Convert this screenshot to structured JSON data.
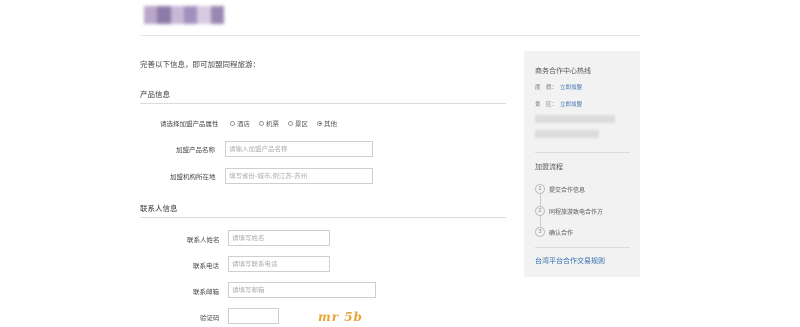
{
  "colors": {
    "logo": [
      "#b9a6c8",
      "#8d7aa8",
      "#c7b8d6",
      "#a38fbd",
      "#d6cbe1",
      "#9a88b3"
    ],
    "accent_link": "#2d6cb0",
    "captcha": "#e6a536"
  },
  "intro": "完善以下信息，即可加盟同程旅游：",
  "product": {
    "section_title": "产品信息",
    "attr_label": "请选择加盟产品属性",
    "options": [
      {
        "label": "酒店",
        "checked": false
      },
      {
        "label": "机票",
        "checked": false
      },
      {
        "label": "景区",
        "checked": false
      },
      {
        "label": "其他",
        "checked": true
      }
    ],
    "name_label": "加盟产品名称",
    "name_placeholder": "请输入加盟产品名称",
    "location_label": "加盟机构所在地",
    "location_placeholder": "填写省份-城市,例江苏-苏州"
  },
  "contact": {
    "section_title": "联系人信息",
    "name_label": "联系人姓名",
    "name_placeholder": "请填写姓名",
    "phone_label": "联系电话",
    "phone_placeholder": "请填写联系电话",
    "email_label": "联系邮箱",
    "email_placeholder": "请填写邮箱",
    "captcha_label": "验证码",
    "captcha_text": "mr 5b"
  },
  "sidebar": {
    "hotline_title": "商务合作中心热线",
    "rows": [
      {
        "label": "度　假：",
        "link": "立即加盟"
      },
      {
        "label": "景　区：",
        "link": "立即加盟"
      }
    ],
    "process_title": "加盟流程",
    "steps": [
      {
        "num": "1",
        "label": "提交合作信息"
      },
      {
        "num": "2",
        "label": "同程旅游致电合作方"
      },
      {
        "num": "3",
        "label": "确认合作"
      }
    ],
    "rules_link": "台湾平台合作交易规则"
  }
}
